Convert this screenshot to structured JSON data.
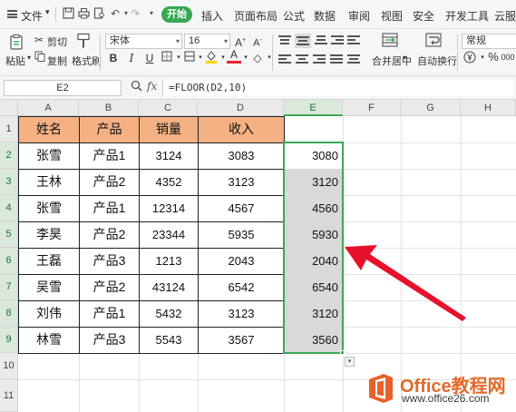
{
  "menu": {
    "file_label": "文件",
    "tabs": [
      "开始",
      "插入",
      "页面布局",
      "公式",
      "数据",
      "审阅",
      "视图",
      "安全",
      "开发工具",
      "云服务"
    ],
    "active_tab": "开始"
  },
  "ribbon": {
    "paste_label": "粘贴",
    "cut_label": "剪切",
    "copy_label": "复制",
    "format_painter_label": "格式刷",
    "font_name": "宋体",
    "font_size": "16",
    "merge_center_label": "合并居中",
    "wrap_text_label": "自动换行",
    "number_format": "常规"
  },
  "formula_bar": {
    "cell_ref": "E2",
    "fx_label": "fx",
    "formula": "=FLOOR(D2,10)"
  },
  "columns": [
    "A",
    "B",
    "C",
    "D",
    "E",
    "F",
    "G",
    "H"
  ],
  "selected_column": "E",
  "rows": [
    "1",
    "2",
    "3",
    "4",
    "5",
    "6",
    "7",
    "8",
    "9",
    "10",
    "11"
  ],
  "table": {
    "headers": [
      "姓名",
      "产品",
      "销量",
      "收入"
    ],
    "rows": [
      [
        "张雪",
        "产品1",
        "3124",
        "3083",
        "3080"
      ],
      [
        "王林",
        "产品2",
        "4352",
        "3123",
        "3120"
      ],
      [
        "张雪",
        "产品1",
        "12314",
        "4567",
        "4560"
      ],
      [
        "李昊",
        "产品2",
        "23344",
        "5935",
        "5930"
      ],
      [
        "王磊",
        "产品3",
        "1213",
        "2043",
        "2040"
      ],
      [
        "吴雪",
        "产品2",
        "43124",
        "6542",
        "6540"
      ],
      [
        "刘伟",
        "产品1",
        "5432",
        "3123",
        "3120"
      ],
      [
        "林雪",
        "产品3",
        "5543",
        "3567",
        "3560"
      ]
    ]
  },
  "colors": {
    "header_fill": "#f4b183",
    "selection": "#3aa857",
    "arrow": "#e8112b",
    "active_tab": "#35a852"
  },
  "watermark": {
    "brand": "Office教程网",
    "url": "www.office26.com"
  }
}
